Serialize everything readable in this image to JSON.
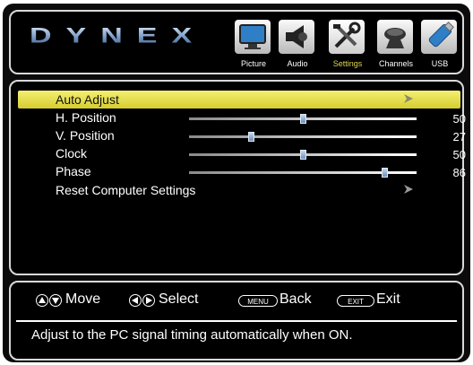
{
  "brand": {
    "logo_text": "DYNEX"
  },
  "tabs": [
    {
      "label": "Picture",
      "icon": "tv-icon",
      "active": false
    },
    {
      "label": "Audio",
      "icon": "speaker-icon",
      "active": false
    },
    {
      "label": "Settings",
      "icon": "tools-icon",
      "active": true
    },
    {
      "label": "Channels",
      "icon": "satellite-dish-icon",
      "active": false
    },
    {
      "label": "USB",
      "icon": "usb-drive-icon",
      "active": false
    }
  ],
  "menu": {
    "items": [
      {
        "label": "Auto Adjust",
        "type": "action",
        "selected": true
      },
      {
        "label": "H. Position",
        "type": "slider",
        "value": "50",
        "level": 0.5
      },
      {
        "label": "V. Position",
        "type": "slider",
        "value": "27",
        "level": 0.27
      },
      {
        "label": "Clock",
        "type": "slider",
        "value": "50",
        "level": 0.5
      },
      {
        "label": "Phase",
        "type": "slider",
        "value": "86",
        "level": 0.86
      },
      {
        "label": "Reset Computer Settings",
        "type": "action",
        "selected": false
      }
    ]
  },
  "hints": {
    "move": "Move",
    "select": "Select",
    "menu_key": "MENU",
    "back": "Back",
    "exit_key": "EXIT",
    "exit": "Exit"
  },
  "description": "Adjust to the PC signal timing automatically when ON.",
  "colors": {
    "accent": "#e1d44a",
    "highlight": "#e8e050",
    "background": "#000000"
  }
}
